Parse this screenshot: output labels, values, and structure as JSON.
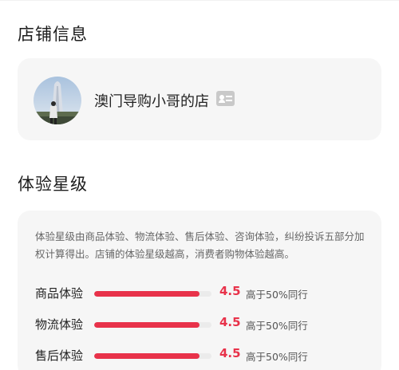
{
  "sections": {
    "shop_info_title": "店铺信息",
    "experience_title": "体验星级"
  },
  "shop": {
    "name": "澳门导购小哥的店",
    "badge_icon": "id-card-icon"
  },
  "experience": {
    "description": "体验星级由商品体验、物流体验、售后体验、咨询体验，纠纷投诉五部分加权计算得出。店铺的体验星级越高，消费者购物体验越高。",
    "rows": [
      {
        "label": "商品体验",
        "score": "4.5",
        "score_value": 4.5,
        "max": 5,
        "compare": "高于50%同行"
      },
      {
        "label": "物流体验",
        "score": "4.5",
        "score_value": 4.5,
        "max": 5,
        "compare": "高于50%同行"
      },
      {
        "label": "售后体验",
        "score": "4.5",
        "score_value": 4.5,
        "max": 5,
        "compare": "高于50%同行"
      }
    ]
  },
  "colors": {
    "accent": "#e8324a",
    "card_bg": "#f6f6f6",
    "track": "#ebebeb"
  }
}
